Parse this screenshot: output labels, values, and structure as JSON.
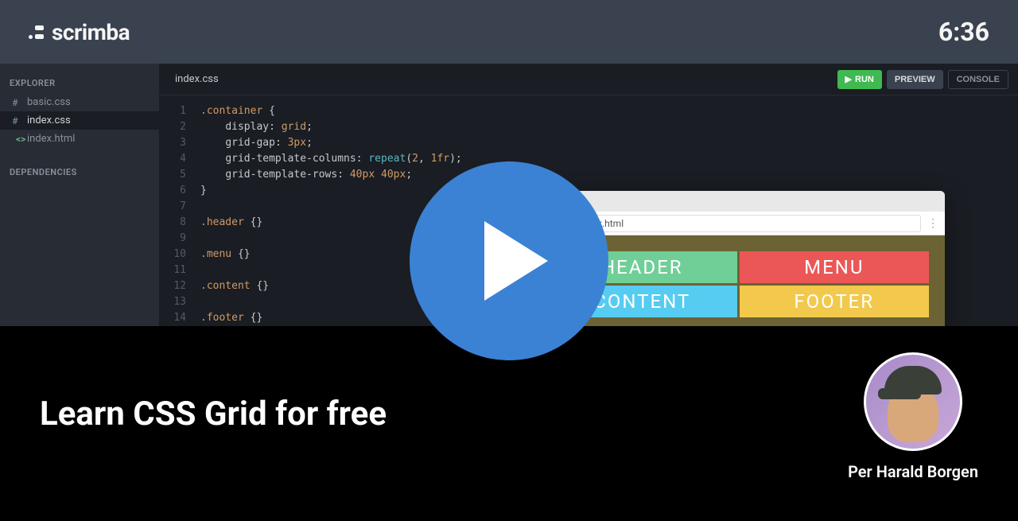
{
  "header": {
    "brand": "scrimba",
    "timer": "6:36"
  },
  "sidebar": {
    "explorer_label": "EXPLORER",
    "dependencies_label": "DEPENDENCIES",
    "files": [
      {
        "icon": "#",
        "name": "basic.css"
      },
      {
        "icon": "#",
        "name": "index.css"
      },
      {
        "icon": "<>",
        "name": "index.html"
      }
    ]
  },
  "editor": {
    "active_tab": "index.css",
    "buttons": {
      "run": "RUN",
      "preview": "PREVIEW",
      "console": "CONSOLE"
    },
    "lines": [
      ".container {",
      "    display: grid;",
      "    grid-gap: 3px;",
      "    grid-template-columns: repeat(2, 1fr);",
      "    grid-template-rows: 40px 40px;",
      "}",
      "",
      ".header {}",
      "",
      ".menu {}",
      "",
      ".content {}",
      "",
      ".footer {}",
      ""
    ]
  },
  "preview": {
    "url": "index.html",
    "cells": {
      "header": "HEADER",
      "menu": "MENU",
      "content": "CONTENT",
      "footer": "FOOTER"
    }
  },
  "overlay": {
    "title": "Learn CSS Grid for free",
    "instructor": "Per Harald Borgen"
  }
}
